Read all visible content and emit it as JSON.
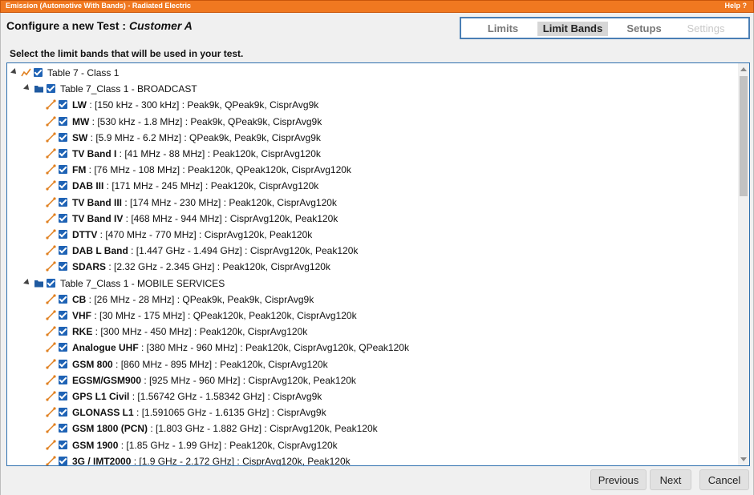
{
  "window": {
    "title": "Emission (Automotive With Bands) - Radiated Electric",
    "help": "Help ?"
  },
  "header": {
    "prefix": "Configure a new Test : ",
    "customer": "Customer A"
  },
  "tabs": [
    {
      "label": "Limits",
      "state": "normal"
    },
    {
      "label": "Limit Bands",
      "state": "active"
    },
    {
      "label": "Setups",
      "state": "normal"
    },
    {
      "label": "Settings",
      "state": "disabled"
    }
  ],
  "instruction": "Select the limit bands that will be used in your test.",
  "tree": {
    "root": {
      "label": "Table 7 - Class 1",
      "checked": true
    },
    "groups": [
      {
        "label": "Table 7_Class 1 - BROADCAST",
        "checked": true,
        "items": [
          {
            "name": "LW",
            "detail": " : [150 kHz - 300 kHz] : Peak9k, QPeak9k, CisprAvg9k",
            "checked": true
          },
          {
            "name": "MW",
            "detail": " : [530 kHz - 1.8 MHz] : Peak9k, QPeak9k, CisprAvg9k",
            "checked": true
          },
          {
            "name": "SW",
            "detail": " : [5.9 MHz - 6.2 MHz] : QPeak9k, Peak9k, CisprAvg9k",
            "checked": true
          },
          {
            "name": "TV Band I",
            "detail": " : [41 MHz - 88 MHz] : Peak120k, CisprAvg120k",
            "checked": true
          },
          {
            "name": "FM",
            "detail": " : [76 MHz - 108 MHz] : Peak120k, QPeak120k, CisprAvg120k",
            "checked": true
          },
          {
            "name": "DAB III",
            "detail": " : [171 MHz - 245 MHz] : Peak120k, CisprAvg120k",
            "checked": true
          },
          {
            "name": "TV Band III",
            "detail": " : [174 MHz - 230 MHz] : Peak120k, CisprAvg120k",
            "checked": true
          },
          {
            "name": "TV Band IV",
            "detail": " : [468 MHz - 944 MHz] : CisprAvg120k, Peak120k",
            "checked": true
          },
          {
            "name": "DTTV",
            "detail": " : [470 MHz - 770 MHz] : CisprAvg120k, Peak120k",
            "checked": true
          },
          {
            "name": "DAB L Band",
            "detail": " : [1.447 GHz - 1.494 GHz] : CisprAvg120k, Peak120k",
            "checked": true
          },
          {
            "name": "SDARS",
            "detail": " : [2.32 GHz - 2.345 GHz] : Peak120k, CisprAvg120k",
            "checked": true
          }
        ]
      },
      {
        "label": "Table 7_Class 1 - MOBILE SERVICES",
        "checked": true,
        "items": [
          {
            "name": "CB",
            "detail": " : [26 MHz - 28 MHz] : QPeak9k, Peak9k, CisprAvg9k",
            "checked": true
          },
          {
            "name": "VHF",
            "detail": " : [30 MHz - 175 MHz] : QPeak120k, Peak120k, CisprAvg120k",
            "checked": true
          },
          {
            "name": "RKE",
            "detail": " : [300 MHz - 450 MHz] : Peak120k, CisprAvg120k",
            "checked": true
          },
          {
            "name": "Analogue UHF",
            "detail": " : [380 MHz - 960 MHz] : Peak120k, CisprAvg120k, QPeak120k",
            "checked": true
          },
          {
            "name": "GSM 800",
            "detail": " : [860 MHz - 895 MHz] : Peak120k, CisprAvg120k",
            "checked": true
          },
          {
            "name": "EGSM/GSM900",
            "detail": " : [925 MHz - 960 MHz] : CisprAvg120k, Peak120k",
            "checked": true
          },
          {
            "name": "GPS L1 Civil",
            "detail": " : [1.56742 GHz - 1.58342 GHz] : CisprAvg9k",
            "checked": true
          },
          {
            "name": "GLONASS L1",
            "detail": " : [1.591065 GHz - 1.6135 GHz] : CisprAvg9k",
            "checked": true
          },
          {
            "name": "GSM 1800 (PCN)",
            "detail": " : [1.803 GHz - 1.882 GHz] : CisprAvg120k, Peak120k",
            "checked": true
          },
          {
            "name": "GSM 1900",
            "detail": " : [1.85 GHz - 1.99 GHz] : Peak120k, CisprAvg120k",
            "checked": true
          },
          {
            "name": "3G / IMT2000",
            "detail": " : [1.9 GHz - 2.172 GHz] : CisprAvg120k, Peak120k",
            "checked": true
          }
        ]
      }
    ]
  },
  "footer": {
    "previous": "Previous",
    "next": "Next",
    "cancel": "Cancel"
  },
  "colors": {
    "titlebar": "#f07820",
    "checkbox": "#1f63b5",
    "folder": "#1f5aa0",
    "band_icon": "#e08020",
    "tree_border": "#2e6fae"
  }
}
